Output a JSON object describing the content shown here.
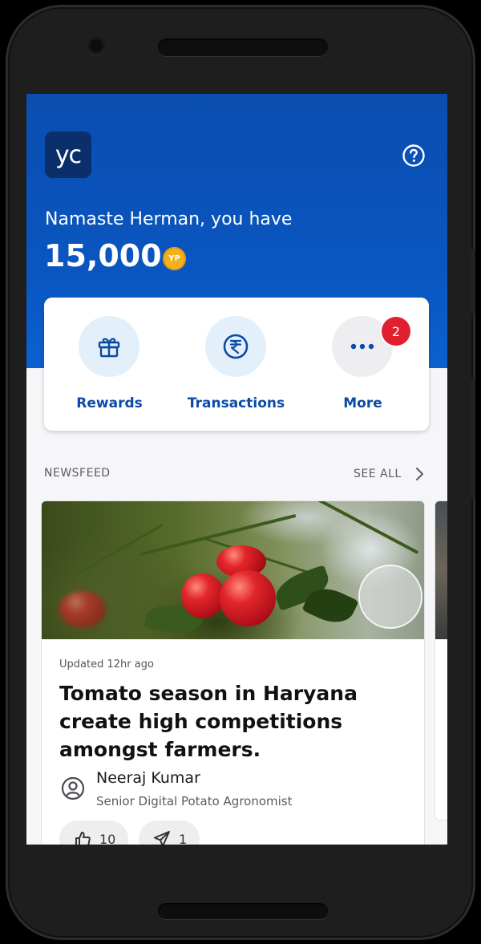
{
  "header": {
    "logo_text": "yc",
    "greeting": "Namaste Herman, you have",
    "balance": "15,000",
    "coin_label": "YP",
    "help_icon": "help-circle-icon"
  },
  "quick_actions": [
    {
      "label": "Rewards",
      "icon": "gift-icon"
    },
    {
      "label": "Transactions",
      "icon": "rupee-icon"
    },
    {
      "label": "More",
      "icon": "more-dots-icon",
      "badge": "2"
    }
  ],
  "newsfeed": {
    "section_title": "NEWSFEED",
    "see_all_label": "SEE ALL",
    "articles": [
      {
        "updated": "Updated 12hr ago",
        "headline": "Tomato season in Haryana create high competitions amongst farmers.",
        "author_name": "Neeraj Kumar",
        "author_role": "Senior Digital Potato Agronomist",
        "likes": "10",
        "shares": "1"
      }
    ]
  },
  "colors": {
    "brand_blue": "#0a55bf",
    "logo_navy": "#0b2f6a",
    "action_text": "#0b4aa6",
    "badge_red": "#e0202e",
    "coin_gold": "#f2b21d"
  }
}
